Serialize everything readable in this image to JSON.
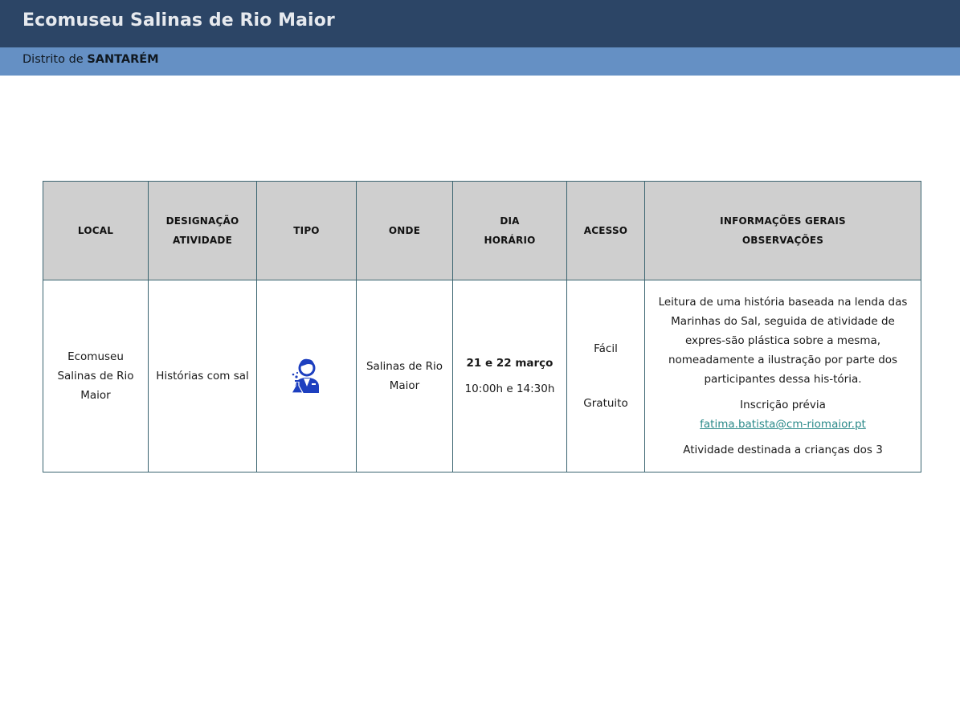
{
  "header": {
    "title": "Ecomuseu Salinas de Rio Maior",
    "district_prefix": "Distrito de ",
    "district_name": "SANTARÉM"
  },
  "colors": {
    "header_bg": "#2c4566",
    "subheader_bg": "#6590c4",
    "table_header_bg": "#cfcfcf",
    "border": "#3a6470",
    "icon": "#1d3fbf",
    "link": "#2c8a8a"
  },
  "table": {
    "columns": {
      "local": "LOCAL",
      "designacao_1": "DESIGNAÇÃO",
      "designacao_2": "ATIVIDADE",
      "tipo": "TIPO",
      "onde": "ONDE",
      "dia_1": "DIA",
      "dia_2": "HORÁRIO",
      "acesso": "ACESSO",
      "info_1": "INFORMAÇÕES GERAIS",
      "info_2": "OBSERVAÇÕES"
    },
    "row": {
      "local": "Ecomuseu Salinas de Rio Maior",
      "designacao": "Histórias com sal",
      "tipo_icon": "scientist-icon",
      "onde": "Salinas de Rio Maior",
      "dia": "21 e 22 março",
      "horario": "10:00h e 14:30h",
      "acesso_1": "Fácil",
      "acesso_2": "Gratuito",
      "info_description": "Leitura de uma história baseada na lenda das Marinhas do Sal, seguida de atividade de expres-são plástica sobre a mesma, nomeadamente a ilustração por parte dos participantes dessa his-tória.",
      "info_registration": "Inscrição prévia",
      "info_email": "fatima.batista@cm-riomaior.pt",
      "info_audience": "Atividade destinada a crianças dos 3"
    }
  }
}
